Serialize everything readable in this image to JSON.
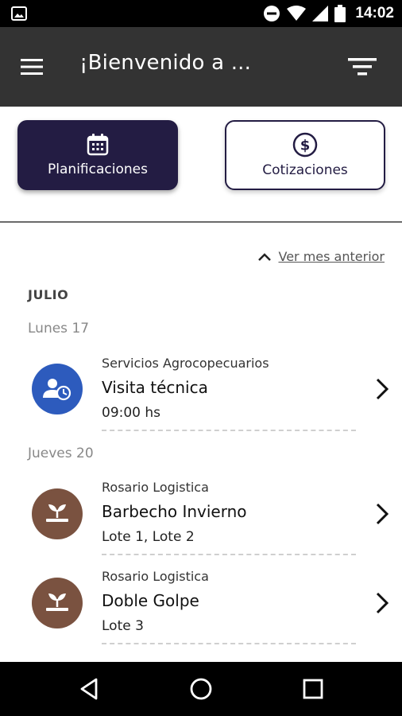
{
  "status_bar": {
    "time": "14:02",
    "icons": [
      "gallery-icon",
      "do-not-disturb-icon",
      "wifi-icon",
      "signal-icon",
      "battery-icon"
    ]
  },
  "app_bar": {
    "title": "¡Bienvenido a ...",
    "icons": [
      "menu-icon",
      "filter-icon"
    ]
  },
  "tabs": [
    {
      "label": "Planificaciones",
      "icon": "calendar-icon",
      "active": true
    },
    {
      "label": "Cotizaciones",
      "icon": "dollar-circle-icon",
      "active": false
    }
  ],
  "content": {
    "prev_month_label": "Ver mes anterior",
    "month": "JULIO",
    "days": [
      {
        "label": "Lunes 17",
        "events": [
          {
            "company": "Servicios Agrocopecuarios",
            "name": "Visita técnica",
            "detail": "09:00 hs",
            "icon": "user-clock-icon",
            "color": "#2d5bbd"
          }
        ]
      },
      {
        "label": "Jueves 20",
        "events": [
          {
            "company": "Rosario Logistica",
            "name": "Barbecho Invierno",
            "detail": "Lote 1, Lote 2",
            "icon": "sprout-icon",
            "color": "#7a5240"
          },
          {
            "company": "Rosario Logistica",
            "name": "Doble Golpe",
            "detail": "Lote 3",
            "icon": "sprout-icon",
            "color": "#7a5240"
          }
        ]
      }
    ]
  },
  "colors": {
    "app_bar": "#333333",
    "primary": "#231c43",
    "visit_blue": "#2d5bbd",
    "crop_brown": "#7a5240"
  },
  "nav_bar": {
    "icons": [
      "back-icon",
      "home-icon",
      "recents-icon"
    ]
  }
}
